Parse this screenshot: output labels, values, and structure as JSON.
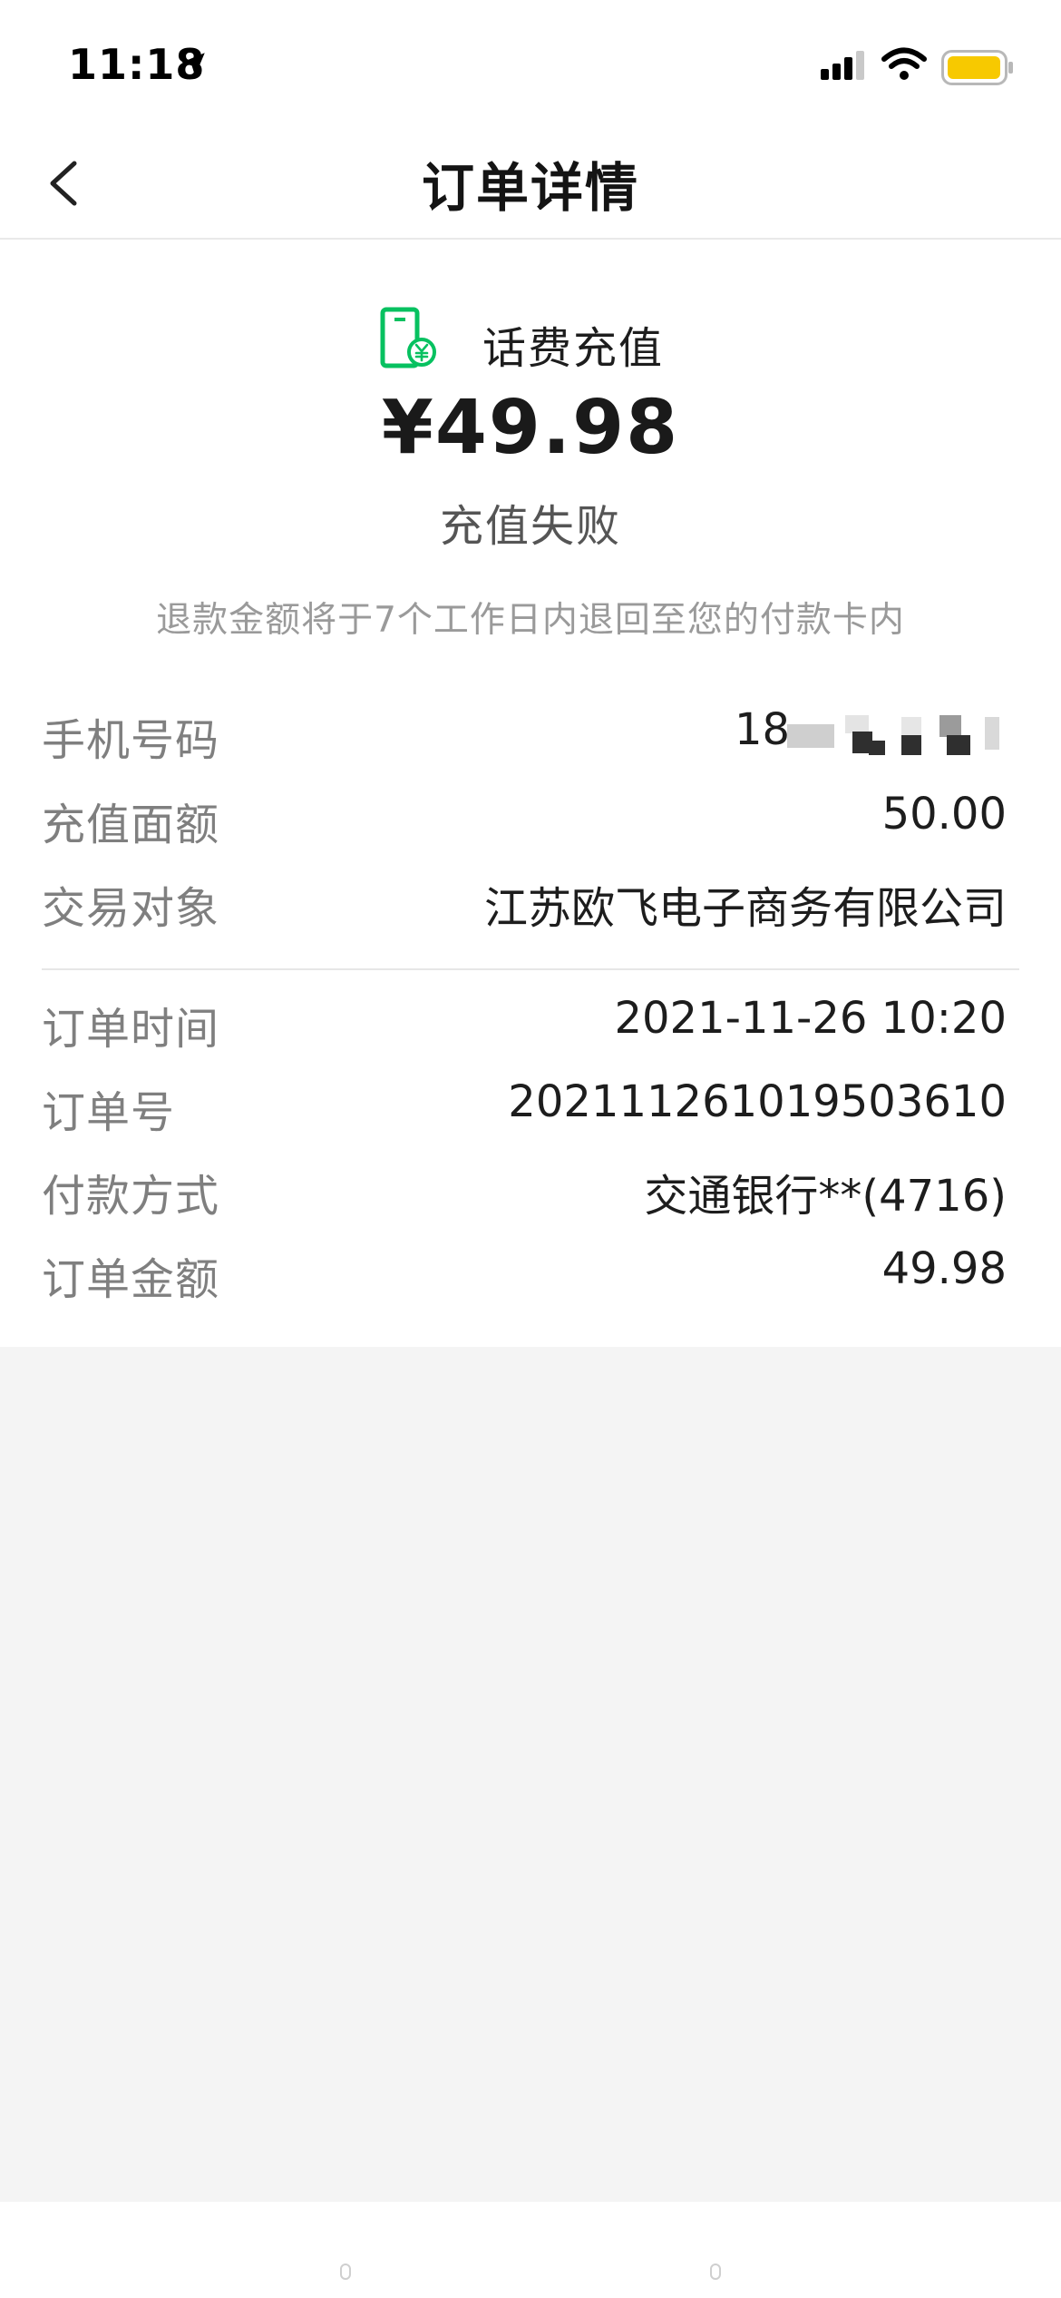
{
  "status_bar": {
    "time": "11:18",
    "location_icon": "location-arrow-icon",
    "signal_icon": "cellular-signal-icon",
    "wifi_icon": "wifi-icon",
    "battery_icon": "battery-icon",
    "battery_color": "#f7c900"
  },
  "nav": {
    "back_icon": "chevron-left-icon",
    "title": "订单详情"
  },
  "order": {
    "product_icon": "phone-recharge-icon",
    "product_name": "话费充值",
    "amount": "¥49.98",
    "status": "充值失败",
    "refund_note": "退款金额将于7个工作日内退回至您的付款卡内",
    "accent_color": "#07c160"
  },
  "details_top": [
    {
      "label": "手机号码",
      "value": "18"
    },
    {
      "label": "充值面额",
      "value": "50.00"
    },
    {
      "label": "交易对象",
      "value": "江苏欧飞电子商务有限公司"
    }
  ],
  "details_bottom": [
    {
      "label": "订单时间",
      "value": "2021-11-26 10:20"
    },
    {
      "label": "订单号",
      "value": "202111261019503610"
    },
    {
      "label": "付款方式",
      "value": "交通银行**(4716)"
    },
    {
      "label": "订单金额",
      "value": "49.98"
    }
  ]
}
